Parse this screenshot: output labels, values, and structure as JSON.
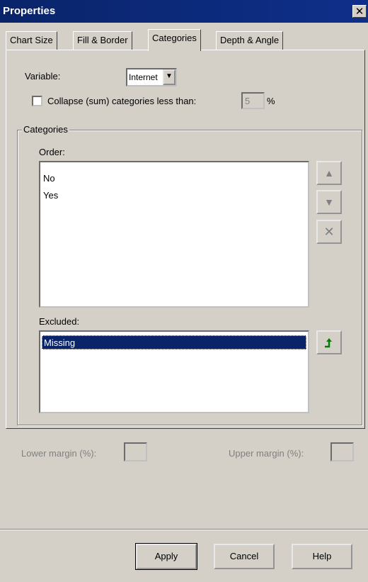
{
  "window": {
    "title": "Properties",
    "close_glyph": "✕"
  },
  "tabs": [
    {
      "label": "Chart Size"
    },
    {
      "label": "Fill & Border"
    },
    {
      "label": "Categories"
    },
    {
      "label": "Depth & Angle"
    }
  ],
  "variable": {
    "label": "Variable:",
    "value": "Internet"
  },
  "collapse": {
    "label": "Collapse (sum) categories less than:",
    "value": "5",
    "unit": "%",
    "checked": false
  },
  "categories_group": {
    "title": "Categories",
    "order_label": "Order:",
    "order_items": [
      "No",
      "Yes"
    ],
    "excluded_label": "Excluded:",
    "excluded_items": [
      "Missing"
    ]
  },
  "margins": {
    "lower_label": "Lower margin (%):",
    "upper_label": "Upper margin (%):"
  },
  "buttons": {
    "apply": "Apply",
    "cancel": "Cancel",
    "help": "Help"
  },
  "icons": {
    "move_up": "arrow-up-icon",
    "move_down": "arrow-down-icon",
    "delete": "delete-x-icon",
    "restore": "restore-arrow-icon",
    "restore_color": "#008000"
  }
}
